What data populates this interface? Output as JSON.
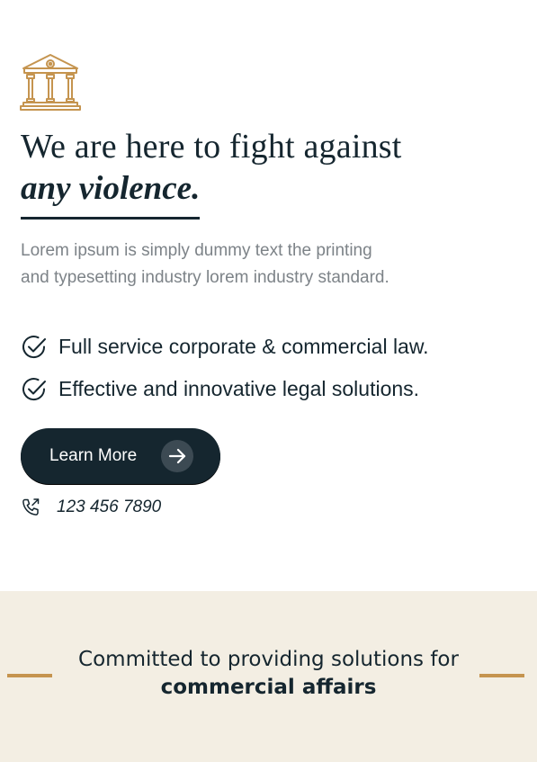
{
  "hero": {
    "logo_icon": "courthouse-icon",
    "heading_line1": "We are here to fight against",
    "heading_line2": "any violence.",
    "description_line1": "Lorem ipsum is simply dummy text the printing",
    "description_line2": "and typesetting industry lorem industry standard.",
    "features": [
      {
        "icon": "check-circle-icon",
        "label": "Full service corporate & commercial law."
      },
      {
        "icon": "check-circle-icon",
        "label": "Effective and innovative legal solutions."
      }
    ],
    "cta": {
      "label": "Learn More",
      "icon": "arrow-right-icon"
    },
    "phone": {
      "icon": "phone-icon",
      "number": "123 456 7890"
    }
  },
  "band": {
    "line1": "Committed to providing solutions for",
    "line2": "commercial affairs"
  },
  "colors": {
    "navy": "#15262f",
    "gold": "#c5944f",
    "muted_text": "#7d8388",
    "band_bg": "#f3eee3"
  }
}
